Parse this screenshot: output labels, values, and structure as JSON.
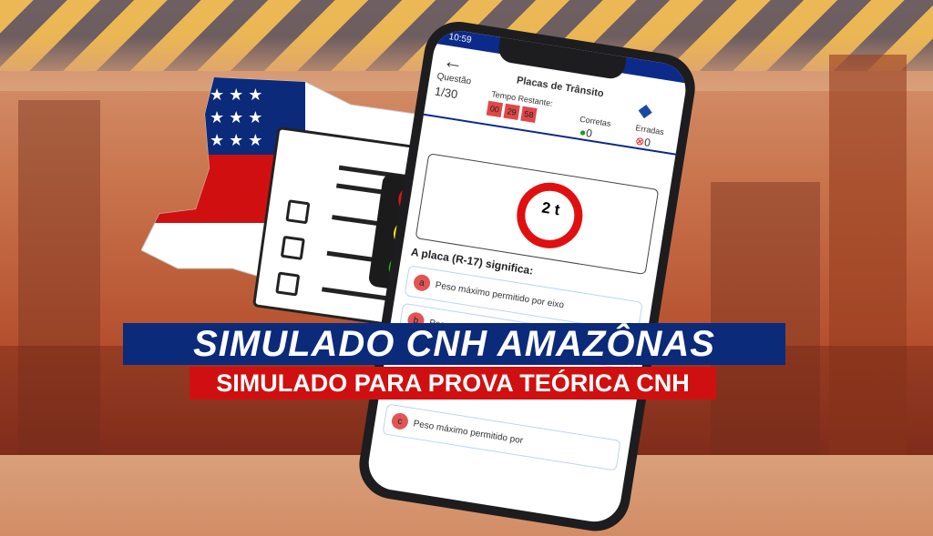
{
  "banner": {
    "title": "SIMULADO CNH AMAZÔNAS",
    "subtitle": "SIMULADO PARA PROVA TEÓRICA CNH"
  },
  "colors": {
    "blue": "#0c2a7a",
    "red": "#d01010"
  },
  "phone": {
    "status_time": "10:59",
    "back_icon": "arrow-left-icon",
    "title": "Placas de Trânsito",
    "question_label": "Questão",
    "question_value": "1/30",
    "timer_label": "Tempo Restante:",
    "timer": [
      "00",
      "29",
      "58"
    ],
    "correct_label": "Corretas",
    "correct_value": "0",
    "wrong_label": "Erradas",
    "wrong_value": "0",
    "sign_text": "2 t",
    "question": "A placa (R-17) significa:",
    "options": [
      {
        "letter": "a",
        "text": "Peso máximo permitido por eixo"
      },
      {
        "letter": "b",
        "text": "Peso"
      },
      {
        "letter": "c",
        "text": "Peso máximo permitido por"
      }
    ]
  }
}
